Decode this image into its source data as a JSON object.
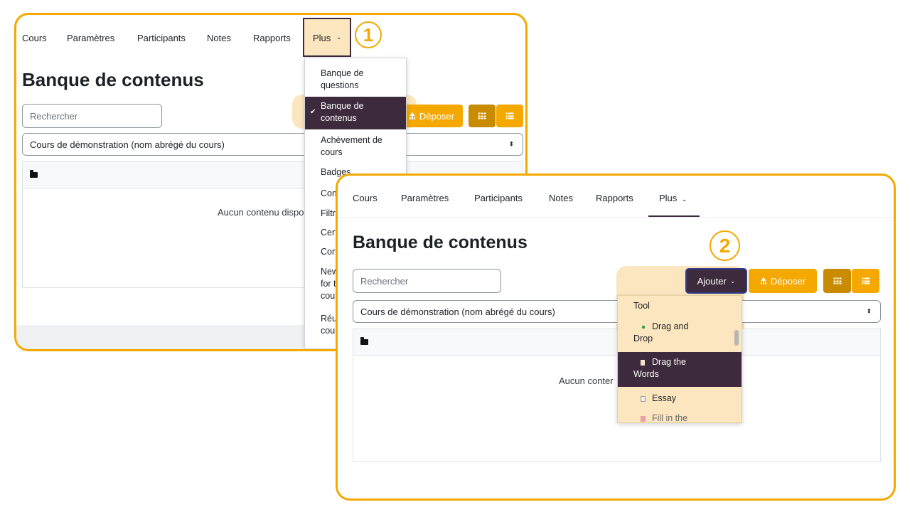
{
  "colors": {
    "accent": "#f5a800",
    "accent_dark": "#c98b00",
    "active_item": "#3d2a3c",
    "highlight": "#fbe6bf"
  },
  "panel1": {
    "nav": {
      "cours": "Cours",
      "parametres": "Paramètres",
      "participants": "Participants",
      "notes": "Notes",
      "rapports": "Rapports",
      "plus": "Plus"
    },
    "title": "Banque de contenus",
    "search_placeholder": "Rechercher",
    "course_select": "Cours de démonstration (nom abrégé du cours)",
    "deposer_label": "Déposer",
    "empty_text": "Aucun contenu dispo",
    "step_badge": "1",
    "dropdown_items": [
      {
        "line1": "Banque de",
        "line2": "questions"
      },
      {
        "line1": "Banque de",
        "line2": "contenus"
      },
      {
        "line1": "Achèvement de",
        "line2": "cours"
      },
      {
        "line1": "Badges",
        "line2": ""
      },
      {
        "line1": "Com",
        "line2": ""
      },
      {
        "line1": "Filtre",
        "line2": ""
      },
      {
        "line1": "Cert",
        "line2": ""
      },
      {
        "line1": "Cort",
        "line2": ""
      },
      {
        "line1": "New",
        "line2": "for t",
        "line3": "cour"
      },
      {
        "line1": "Réu",
        "line2": "cour"
      }
    ]
  },
  "panel2": {
    "nav": {
      "cours": "Cours",
      "parametres": "Paramètres",
      "participants": "Participants",
      "notes": "Notes",
      "rapports": "Rapports",
      "plus": "Plus"
    },
    "title": "Banque de contenus",
    "search_placeholder": "Rechercher",
    "course_select": "Cours de démonstration (nom abrégé du cours)",
    "ajouter_label": "Ajouter",
    "deposer_label": "Déposer",
    "empty_text": "Aucun conter",
    "step_badge": "2",
    "dropdown": {
      "tool": "Tool",
      "drag_drop_l1": "Drag and",
      "drag_drop_l2": "Drop",
      "drag_words_l1": "Drag the",
      "drag_words_l2": "Words",
      "essay": "Essay",
      "fill": "Fill in the"
    }
  }
}
